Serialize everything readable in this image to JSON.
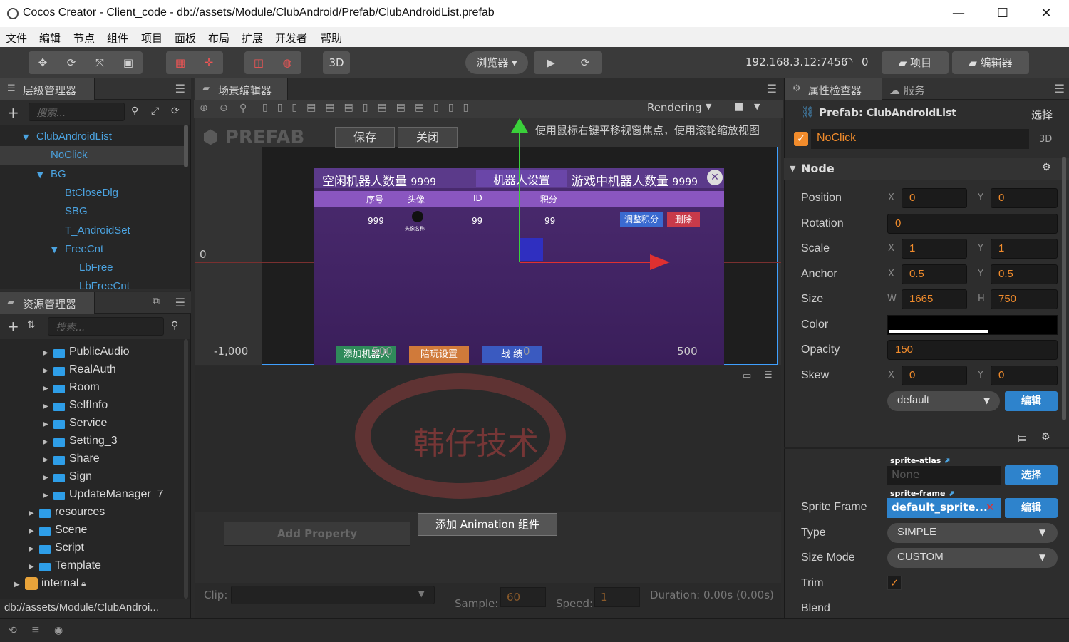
{
  "window": {
    "title": "Cocos Creator - Client_code - db://assets/Module/ClubAndroid/Prefab/ClubAndroidList.prefab",
    "controls": [
      "—",
      "☐",
      "✕"
    ]
  },
  "menubar": [
    "文件",
    "编辑",
    "节点",
    "组件",
    "项目",
    "面板",
    "布局",
    "扩展",
    "开发者",
    "帮助"
  ],
  "toolbar": {
    "mode_3d": "3D",
    "browser": "浏览器 ▾",
    "ip": "192.168.3.12:7456",
    "wifi_count": "0",
    "project_btn": "项目",
    "editor_btn": "编辑器"
  },
  "hierarchy": {
    "tab": "层级管理器",
    "search_placeholder": "搜索...",
    "nodes": [
      "ClubAndroidList",
      "NoClick",
      "BG",
      "BtCloseDlg",
      "SBG",
      "T_AndroidSet",
      "FreeCnt",
      "LbFree",
      "LbFreeCnt"
    ]
  },
  "assets": {
    "tab": "资源管理器",
    "search_placeholder": "搜索...",
    "items": [
      "PublicAudio",
      "RealAuth",
      "Room",
      "SelfInfo",
      "Service",
      "Setting_3",
      "Share",
      "Sign",
      "UpdateManager_7",
      "resources",
      "Scene",
      "Script",
      "Template",
      "internal"
    ],
    "path": "db://assets/Module/ClubAndroi..."
  },
  "scene": {
    "tab": "场景编辑器",
    "rendering": "Rendering",
    "hint": "使用鼠标右键平移视窗焦点，使用滚轮缩放视图",
    "prefab_label": "PREFAB",
    "save_btn": "保存",
    "close_btn": "关闭",
    "ruler_zero_y": "0",
    "ruler_x_neg": "-1,000",
    "ruler_x_zero": "0",
    "ruler_x_500": "500",
    "ruler_x_500b": "500",
    "game": {
      "idle": "空闲机器人数量",
      "idle_count": "9999",
      "settings": "机器人设置",
      "playing": "游戏中机器人数量",
      "playing_count": "9999",
      "headers": [
        "序号",
        "头像",
        "ID",
        "积分"
      ],
      "row": [
        "999",
        "",
        "99",
        "99"
      ],
      "avatar_caption": "头像名称",
      "btn_score": "调整积分",
      "btn_delete": "删除",
      "btn_add": "添加机器人",
      "btn_play": "陪玩设置",
      "btn_battle": "战 绩"
    }
  },
  "animation": {
    "add_property": "Add Property",
    "add_component": "添加 Animation 组件",
    "clip_label": "Clip:",
    "sample_label": "Sample:",
    "sample_value": "60",
    "speed_label": "Speed:",
    "speed_value": "1",
    "duration": "Duration: 0.00s (0.00s)"
  },
  "watermark": "韩仔技术",
  "inspector": {
    "tab": "属性检查器",
    "tab2": "服务",
    "prefab_label": "Prefab:",
    "prefab_name": "ClubAndroidList",
    "select_btn": "选择",
    "node_name": "NoClick",
    "label_3d": "3D",
    "section": "Node",
    "props": {
      "position": {
        "label": "Position",
        "x": "0",
        "y": "0"
      },
      "rotation": {
        "label": "Rotation",
        "v": "0"
      },
      "scale": {
        "label": "Scale",
        "x": "1",
        "y": "1"
      },
      "anchor": {
        "label": "Anchor",
        "x": "0.5",
        "y": "0.5"
      },
      "size": {
        "label": "Size",
        "w": "1665",
        "h": "750"
      },
      "color": {
        "label": "Color",
        "value": "#000000"
      },
      "opacity": {
        "label": "Opacity",
        "v": "150"
      },
      "skew": {
        "label": "Skew",
        "x": "0",
        "y": "0"
      }
    },
    "group_value": "default",
    "edit_btn": "编辑",
    "atlas_tag": "sprite-atlas",
    "atlas_value": "None",
    "frame_tag": "sprite-frame",
    "sprite_frame_label": "Sprite Frame",
    "frame_value": "default_sprite...",
    "type_label": "Type",
    "type_value": "SIMPLE",
    "size_mode_label": "Size Mode",
    "size_mode_value": "CUSTOM",
    "trim_label": "Trim",
    "blend_label": "Blend"
  },
  "colors": {
    "accent_orange": "#f28c2c",
    "node_blue": "#4ba3e0",
    "folder_blue": "#2e9ee8",
    "button_blue": "#2e83cc"
  }
}
